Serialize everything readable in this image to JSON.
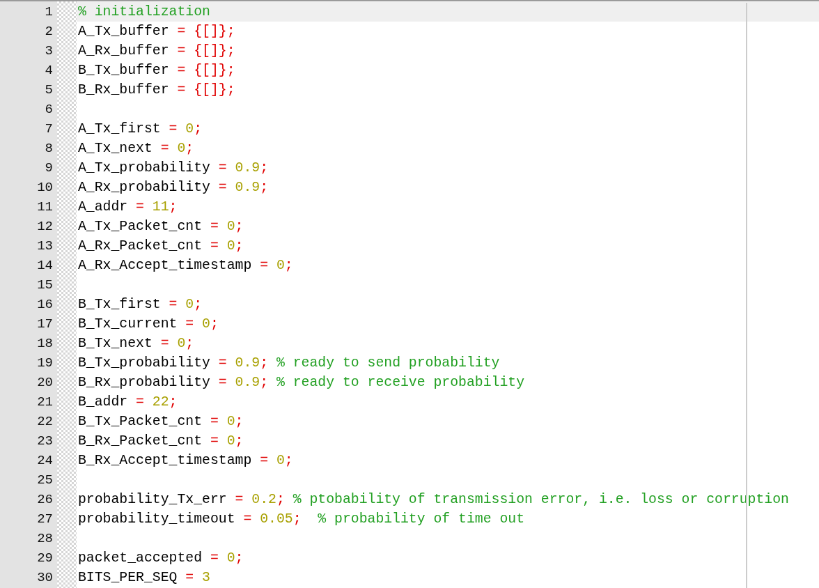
{
  "editor": {
    "lines": [
      {
        "number": "1",
        "current": true,
        "tokens": [
          {
            "kind": "comment",
            "text": "% initialization"
          }
        ]
      },
      {
        "number": "2",
        "current": false,
        "tokens": [
          {
            "kind": "ident",
            "text": "A_Tx_buffer "
          },
          {
            "kind": "op",
            "text": "= {[]};"
          }
        ]
      },
      {
        "number": "3",
        "current": false,
        "tokens": [
          {
            "kind": "ident",
            "text": "A_Rx_buffer "
          },
          {
            "kind": "op",
            "text": "= {[]};"
          }
        ]
      },
      {
        "number": "4",
        "current": false,
        "tokens": [
          {
            "kind": "ident",
            "text": "B_Tx_buffer "
          },
          {
            "kind": "op",
            "text": "= {[]};"
          }
        ]
      },
      {
        "number": "5",
        "current": false,
        "tokens": [
          {
            "kind": "ident",
            "text": "B_Rx_buffer "
          },
          {
            "kind": "op",
            "text": "= {[]};"
          }
        ]
      },
      {
        "number": "6",
        "current": false
      },
      {
        "number": "7",
        "current": false,
        "tokens": [
          {
            "kind": "ident",
            "text": "A_Tx_first "
          },
          {
            "kind": "op",
            "text": "= "
          },
          {
            "kind": "num",
            "text": "0"
          },
          {
            "kind": "op",
            "text": ";"
          }
        ]
      },
      {
        "number": "8",
        "current": false,
        "tokens": [
          {
            "kind": "ident",
            "text": "A_Tx_next "
          },
          {
            "kind": "op",
            "text": "= "
          },
          {
            "kind": "num",
            "text": "0"
          },
          {
            "kind": "op",
            "text": ";"
          }
        ]
      },
      {
        "number": "9",
        "current": false,
        "tokens": [
          {
            "kind": "ident",
            "text": "A_Tx_probability "
          },
          {
            "kind": "op",
            "text": "= "
          },
          {
            "kind": "num",
            "text": "0.9"
          },
          {
            "kind": "op",
            "text": ";"
          }
        ]
      },
      {
        "number": "10",
        "current": false,
        "tokens": [
          {
            "kind": "ident",
            "text": "A_Rx_probability "
          },
          {
            "kind": "op",
            "text": "= "
          },
          {
            "kind": "num",
            "text": "0.9"
          },
          {
            "kind": "op",
            "text": ";"
          }
        ]
      },
      {
        "number": "11",
        "current": false,
        "tokens": [
          {
            "kind": "ident",
            "text": "A_addr "
          },
          {
            "kind": "op",
            "text": "= "
          },
          {
            "kind": "num",
            "text": "11"
          },
          {
            "kind": "op",
            "text": ";"
          }
        ]
      },
      {
        "number": "12",
        "current": false,
        "tokens": [
          {
            "kind": "ident",
            "text": "A_Tx_Packet_cnt "
          },
          {
            "kind": "op",
            "text": "= "
          },
          {
            "kind": "num",
            "text": "0"
          },
          {
            "kind": "op",
            "text": ";"
          }
        ]
      },
      {
        "number": "13",
        "current": false,
        "tokens": [
          {
            "kind": "ident",
            "text": "A_Rx_Packet_cnt "
          },
          {
            "kind": "op",
            "text": "= "
          },
          {
            "kind": "num",
            "text": "0"
          },
          {
            "kind": "op",
            "text": ";"
          }
        ]
      },
      {
        "number": "14",
        "current": false,
        "tokens": [
          {
            "kind": "ident",
            "text": "A_Rx_Accept_timestamp "
          },
          {
            "kind": "op",
            "text": "= "
          },
          {
            "kind": "num",
            "text": "0"
          },
          {
            "kind": "op",
            "text": ";"
          }
        ]
      },
      {
        "number": "15",
        "current": false
      },
      {
        "number": "16",
        "current": false,
        "tokens": [
          {
            "kind": "ident",
            "text": "B_Tx_first "
          },
          {
            "kind": "op",
            "text": "= "
          },
          {
            "kind": "num",
            "text": "0"
          },
          {
            "kind": "op",
            "text": ";"
          }
        ]
      },
      {
        "number": "17",
        "current": false,
        "tokens": [
          {
            "kind": "ident",
            "text": "B_Tx_current "
          },
          {
            "kind": "op",
            "text": "= "
          },
          {
            "kind": "num",
            "text": "0"
          },
          {
            "kind": "op",
            "text": ";"
          }
        ]
      },
      {
        "number": "18",
        "current": false,
        "tokens": [
          {
            "kind": "ident",
            "text": "B_Tx_next "
          },
          {
            "kind": "op",
            "text": "= "
          },
          {
            "kind": "num",
            "text": "0"
          },
          {
            "kind": "op",
            "text": ";"
          }
        ]
      },
      {
        "number": "19",
        "current": false,
        "tokens": [
          {
            "kind": "ident",
            "text": "B_Tx_probability "
          },
          {
            "kind": "op",
            "text": "= "
          },
          {
            "kind": "num",
            "text": "0.9"
          },
          {
            "kind": "op",
            "text": "; "
          },
          {
            "kind": "comment",
            "text": "% ready to send probability"
          }
        ]
      },
      {
        "number": "20",
        "current": false,
        "tokens": [
          {
            "kind": "ident",
            "text": "B_Rx_probability "
          },
          {
            "kind": "op",
            "text": "= "
          },
          {
            "kind": "num",
            "text": "0.9"
          },
          {
            "kind": "op",
            "text": "; "
          },
          {
            "kind": "comment",
            "text": "% ready to receive probability"
          }
        ]
      },
      {
        "number": "21",
        "current": false,
        "tokens": [
          {
            "kind": "ident",
            "text": "B_addr "
          },
          {
            "kind": "op",
            "text": "= "
          },
          {
            "kind": "num",
            "text": "22"
          },
          {
            "kind": "op",
            "text": ";"
          }
        ]
      },
      {
        "number": "22",
        "current": false,
        "tokens": [
          {
            "kind": "ident",
            "text": "B_Tx_Packet_cnt "
          },
          {
            "kind": "op",
            "text": "= "
          },
          {
            "kind": "num",
            "text": "0"
          },
          {
            "kind": "op",
            "text": ";"
          }
        ]
      },
      {
        "number": "23",
        "current": false,
        "tokens": [
          {
            "kind": "ident",
            "text": "B_Rx_Packet_cnt "
          },
          {
            "kind": "op",
            "text": "= "
          },
          {
            "kind": "num",
            "text": "0"
          },
          {
            "kind": "op",
            "text": ";"
          }
        ]
      },
      {
        "number": "24",
        "current": false,
        "tokens": [
          {
            "kind": "ident",
            "text": "B_Rx_Accept_timestamp "
          },
          {
            "kind": "op",
            "text": "= "
          },
          {
            "kind": "num",
            "text": "0"
          },
          {
            "kind": "op",
            "text": ";"
          }
        ]
      },
      {
        "number": "25",
        "current": false
      },
      {
        "number": "26",
        "current": false,
        "tokens": [
          {
            "kind": "ident",
            "text": "probability_Tx_err "
          },
          {
            "kind": "op",
            "text": "= "
          },
          {
            "kind": "num",
            "text": "0.2"
          },
          {
            "kind": "op",
            "text": "; "
          },
          {
            "kind": "comment",
            "text": "% ptobability of transmission error, i.e. loss or corruption"
          }
        ]
      },
      {
        "number": "27",
        "current": false,
        "tokens": [
          {
            "kind": "ident",
            "text": "probability_timeout "
          },
          {
            "kind": "op",
            "text": "= "
          },
          {
            "kind": "num",
            "text": "0.05"
          },
          {
            "kind": "op",
            "text": ";  "
          },
          {
            "kind": "comment",
            "text": "% probability of time out"
          }
        ]
      },
      {
        "number": "28",
        "current": false
      },
      {
        "number": "29",
        "current": false,
        "tokens": [
          {
            "kind": "ident",
            "text": "packet_accepted "
          },
          {
            "kind": "op",
            "text": "= "
          },
          {
            "kind": "num",
            "text": "0"
          },
          {
            "kind": "op",
            "text": ";"
          }
        ]
      },
      {
        "number": "30",
        "current": false,
        "tokens": [
          {
            "kind": "ident",
            "text": "BITS_PER_SEQ "
          },
          {
            "kind": "op",
            "text": "= "
          },
          {
            "kind": "num",
            "text": "3"
          }
        ]
      }
    ]
  }
}
